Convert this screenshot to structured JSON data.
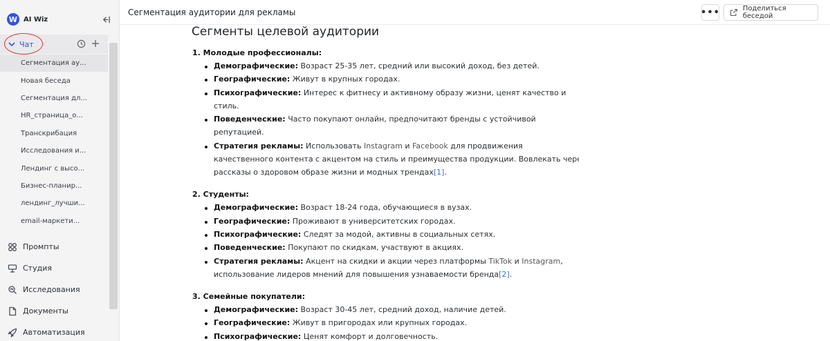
{
  "app": {
    "name": "AI Wiz",
    "logo_letter": "W",
    "accent": "#2f54eb"
  },
  "sidebar": {
    "chat_label": "Чат",
    "chats": [
      "Сегментация ау...",
      "Новая беседа",
      "Сегментация дл...",
      "HR_страница_о...",
      "Транскрибация",
      "Исследования и...",
      "Лендинг с высо...",
      "Бизнес-планир...",
      "лендинг_лучши...",
      "email-маркети..."
    ],
    "nav": [
      {
        "label": "Промпты",
        "icon": "prompts-icon"
      },
      {
        "label": "Студия",
        "icon": "studio-icon"
      },
      {
        "label": "Исследования",
        "icon": "research-icon"
      },
      {
        "label": "Документы",
        "icon": "documents-icon"
      },
      {
        "label": "Автоматизация",
        "icon": "rocket-icon"
      }
    ]
  },
  "header": {
    "title": "Сегментация аудитории для рекламы",
    "more_label": "•••",
    "share_label": "Поделиться беседой"
  },
  "content": {
    "heading": "Сегменты целевой аудитории",
    "s1": {
      "title": "1. Молодые профессионалы:",
      "b1_k": "Демографические:",
      "b1_v": " Возраст 25-35 лет, средний или высокий доход, без детей.",
      "b2_k": "Географические:",
      "b2_v": " Живут в крупных городах.",
      "b3_k": "Психографические:",
      "b3_v": " Интерес к фитнесу и активному образу жизни, ценят качество и",
      "b3_c": "стиль.",
      "b4_k": "Поведенческие:",
      "b4_v": " Часто покупают онлайн, предпочитают бренды с устойчивой",
      "b4_c": "репутацией.",
      "b5_k": "Стратегия рекламы:",
      "b5_v1": " Использовать ",
      "b5_w1": "Instagram",
      "b5_v2": " и ",
      "b5_w2": "Facebook",
      "b5_v3": " для продвижения",
      "b5_c1": "качественного контента с акцентом на стиль и преимущества продукции. Вовлекать через",
      "b5_c2": "рассказы о здоровом образе жизни и модных трендах",
      "b5_ref": "[1]",
      "b5_end": "."
    },
    "s2": {
      "title": "2. Студенты:",
      "b1_k": "Демографические:",
      "b1_v": " Возраст 18-24 года, обучающиеся в вузах.",
      "b2_k": "Географические:",
      "b2_v": " Проживают в университетских городах.",
      "b3_k": "Психографические:",
      "b3_v": " Следят за модой, активны в социальных сетях.",
      "b4_k": "Поведенческие:",
      "b4_v": " Покупают по скидкам, участвуют в акциях.",
      "b5_k": "Стратегия рекламы:",
      "b5_v1": " Акцент на скидки и акции через платформы ",
      "b5_w1": "TikTok",
      "b5_v2": " и ",
      "b5_w2": "Instagram",
      "b5_v3": ",",
      "b5_c1": "использование лидеров мнений для повышения узнаваемости бренда",
      "b5_ref": "[2]",
      "b5_end": "."
    },
    "s3": {
      "title": "3. Семейные покупатели:",
      "b1_k": "Демографические:",
      "b1_v": " Возраст 30-45 лет, средний доход, наличие детей.",
      "b2_k": "Географические:",
      "b2_v": " Живут в пригородах или крупных городах.",
      "b3_k": "Психографические:",
      "b3_v": " Ценят комфорт и долговечность."
    }
  }
}
